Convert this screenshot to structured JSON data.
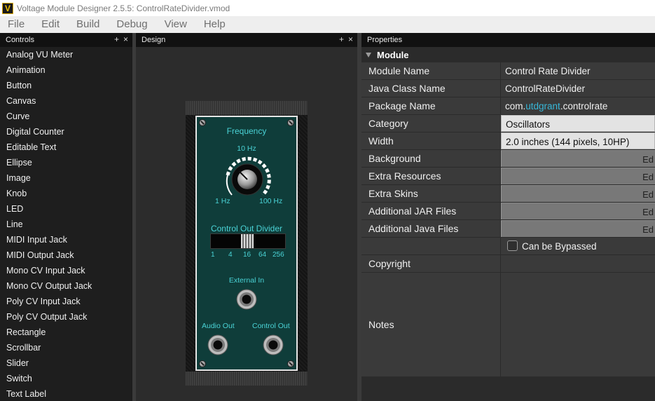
{
  "window": {
    "title": "Voltage Module Designer 2.5.5: ControlRateDivider.vmod",
    "icon_letter": "V"
  },
  "menu": [
    "File",
    "Edit",
    "Build",
    "Debug",
    "View",
    "Help"
  ],
  "panels": {
    "controls": {
      "title": "Controls",
      "plus": "+",
      "close": "×"
    },
    "design": {
      "title": "Design",
      "plus": "+",
      "close": "×"
    },
    "properties": {
      "title": "Properties"
    }
  },
  "controls_list": [
    "Analog VU Meter",
    "Animation",
    "Button",
    "Canvas",
    "Curve",
    "Digital Counter",
    "Editable Text",
    "Ellipse",
    "Image",
    "Knob",
    "LED",
    "Line",
    "MIDI Input Jack",
    "MIDI Output Jack",
    "Mono CV Input Jack",
    "Mono CV Output Jack",
    "Poly CV Input Jack",
    "Poly CV Output Jack",
    "Rectangle",
    "Scrollbar",
    "Slider",
    "Switch",
    "Text Label"
  ],
  "module_panel": {
    "frequency_title": "Frequency",
    "freq_top": "10 Hz",
    "freq_min": "1 Hz",
    "freq_max": "100 Hz",
    "divider_title": "Control Out Divider",
    "divider_ticks": [
      "1",
      "4",
      "16",
      "64",
      "256"
    ],
    "external_in": "External In",
    "audio_out": "Audio Out",
    "control_out": "Control Out"
  },
  "properties": {
    "section": "Module",
    "module_name": {
      "key": "Module Name",
      "value": "Control Rate Divider"
    },
    "java_class": {
      "key": "Java Class Name",
      "value": "ControlRateDivider"
    },
    "package": {
      "key": "Package Name",
      "prefix": "com.",
      "highlight": "utdgrant",
      "suffix": ".controlrate"
    },
    "category": {
      "key": "Category",
      "value": "Oscillators"
    },
    "width": {
      "key": "Width",
      "value": "2.0 inches (144 pixels, 10HP)"
    },
    "background": {
      "key": "Background",
      "button": "Ed"
    },
    "extra_resources": {
      "key": "Extra Resources",
      "button": "Ed"
    },
    "extra_skins": {
      "key": "Extra Skins",
      "button": "Ed"
    },
    "jar_files": {
      "key": "Additional JAR Files",
      "button": "Ed"
    },
    "java_files": {
      "key": "Additional Java Files",
      "button": "Ed"
    },
    "bypass": {
      "label": "Can be Bypassed"
    },
    "copyright": {
      "key": "Copyright",
      "value": ""
    },
    "notes": {
      "key": "Notes",
      "value": ""
    }
  },
  "colors": {
    "accent_teal": "#4ad3d6",
    "faceplate": "#0f3d3a",
    "link_blue": "#37b7d8"
  }
}
